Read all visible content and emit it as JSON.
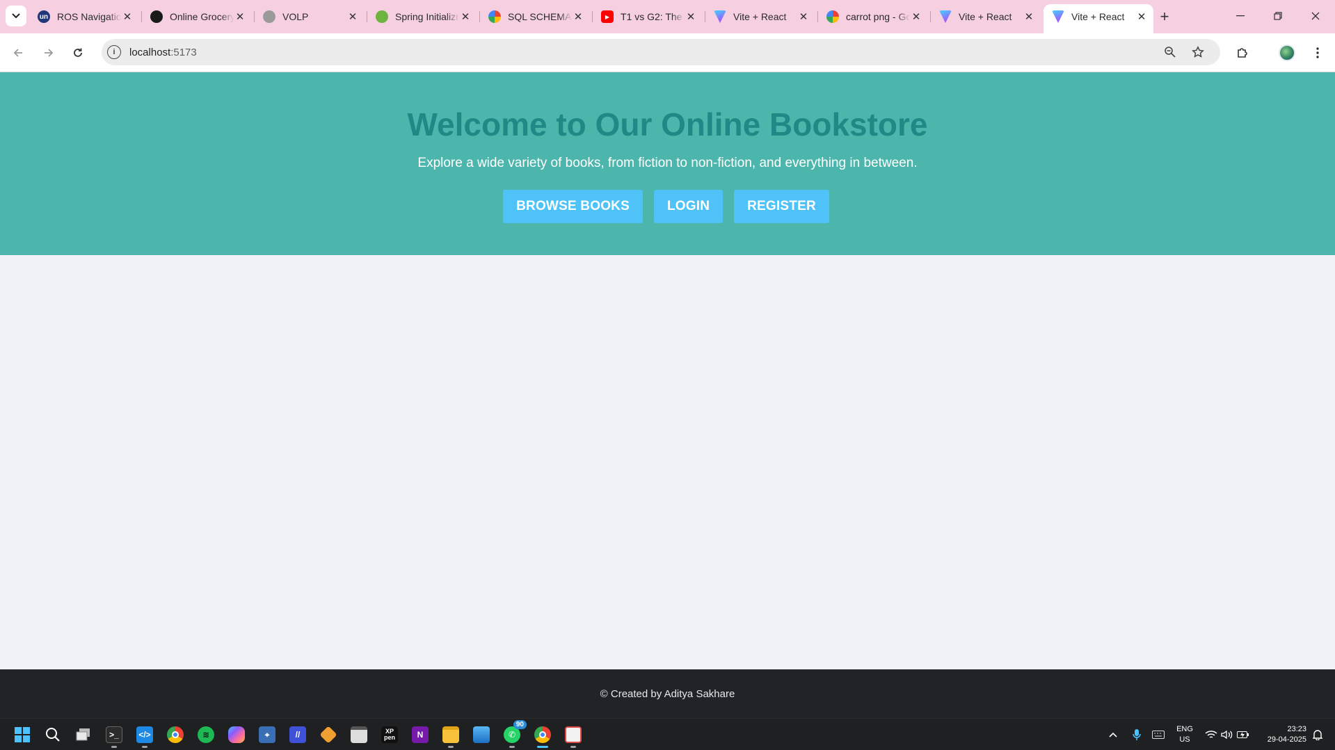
{
  "browser": {
    "tabs": [
      {
        "title": "ROS Navigation",
        "favicon": "ros-un-icon",
        "color": "#22367a",
        "active": false
      },
      {
        "title": "Online Grocery",
        "favicon": "chatgpt-icon",
        "color": "#1a1a1a",
        "active": false
      },
      {
        "title": "VOLP",
        "favicon": "globe-icon",
        "color": "#9a9a9a",
        "active": false
      },
      {
        "title": "Spring Initializr",
        "favicon": "spring-icon",
        "color": "#6db33f",
        "active": false
      },
      {
        "title": "SQL SCHEMA",
        "favicon": "google-icon",
        "color": "#4285f4",
        "active": false
      },
      {
        "title": "T1 vs G2: The",
        "favicon": "youtube-icon",
        "color": "#ff0000",
        "active": false
      },
      {
        "title": "Vite + React",
        "favicon": "vite-icon",
        "color": "#9b5cff",
        "active": false
      },
      {
        "title": "carrot png - Google",
        "favicon": "google-icon",
        "color": "#4285f4",
        "active": false
      },
      {
        "title": "Vite + React",
        "favicon": "vite-icon",
        "color": "#9b5cff",
        "active": false
      },
      {
        "title": "Vite + React",
        "favicon": "vite-icon",
        "color": "#9b5cff",
        "active": true
      }
    ],
    "address": {
      "host": "localhost",
      "port": ":5173"
    }
  },
  "hero": {
    "title": "Welcome to Our Online Bookstore",
    "subtitle": "Explore a wide variety of books, from fiction to non-fiction, and everything in between.",
    "buttons": [
      {
        "label": "BROWSE BOOKS",
        "name": "browse-books-button"
      },
      {
        "label": "LOGIN",
        "name": "login-button"
      },
      {
        "label": "REGISTER",
        "name": "register-button"
      }
    ]
  },
  "footer": {
    "text": "© Created by Aditya Sakhare"
  },
  "taskbar": {
    "whatsapp_badge": "90",
    "lang_line1": "ENG",
    "lang_line2": "US",
    "time": "23:23",
    "date": "29-04-2025"
  },
  "colors": {
    "tabstrip": "#f6cfe1",
    "hero_bg": "#4db6ac",
    "hero_title": "#1f8a85",
    "button_bg": "#4fc3f7",
    "page_bg": "#f0f2f7",
    "footer_bg": "#202429"
  }
}
